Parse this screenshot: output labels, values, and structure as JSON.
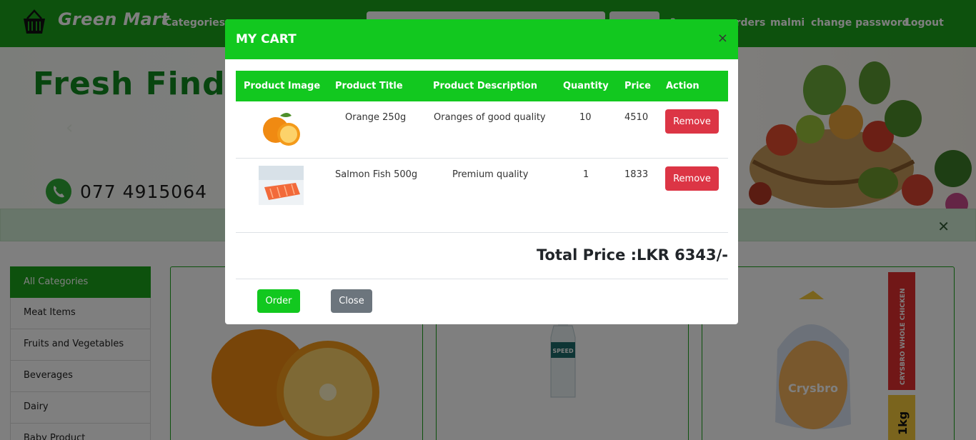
{
  "navbar": {
    "brand": "Green Mart",
    "categories_label": "Categories",
    "cart_label": "?",
    "orders_label": "orders",
    "user_label": "malmi",
    "change_password_label": "change password",
    "logout_label": "Logout"
  },
  "banner": {
    "title": "Fresh Finds, Gr",
    "phone": "077 4915064"
  },
  "sidebar": {
    "items": [
      {
        "label": "All Categories"
      },
      {
        "label": "Meat Items"
      },
      {
        "label": "Fruits and Vegetables"
      },
      {
        "label": "Beverages"
      },
      {
        "label": "Dairy"
      },
      {
        "label": "Baby Product"
      }
    ]
  },
  "products": {
    "water_label": "SPEED",
    "chicken_brand": "Crysbro",
    "chicken_side": "CRYSBRO WHOLE CHICKEN",
    "chicken_weight": "1kg"
  },
  "modal": {
    "title": "MY CART",
    "close_symbol": "×",
    "columns": [
      "Product Image",
      "Product Title",
      "Product Description",
      "Quantity",
      "Price",
      "Action"
    ],
    "rows": [
      {
        "title": "Orange 250g",
        "description": "Oranges of good quality",
        "quantity": "10",
        "price": "4510",
        "action": "Remove",
        "image": "orange-image"
      },
      {
        "title": "Salmon Fish 500g",
        "description": "Premium quality",
        "quantity": "1",
        "price": "1833",
        "action": "Remove",
        "image": "salmon-image"
      }
    ],
    "total": "Total Price :LKR 6343/-",
    "order_label": "Order",
    "close_label": "Close"
  },
  "colors": {
    "brand_green": "#1aa31a",
    "modal_green": "#12c81f",
    "danger": "#dc3545",
    "secondary": "#6c757d"
  }
}
